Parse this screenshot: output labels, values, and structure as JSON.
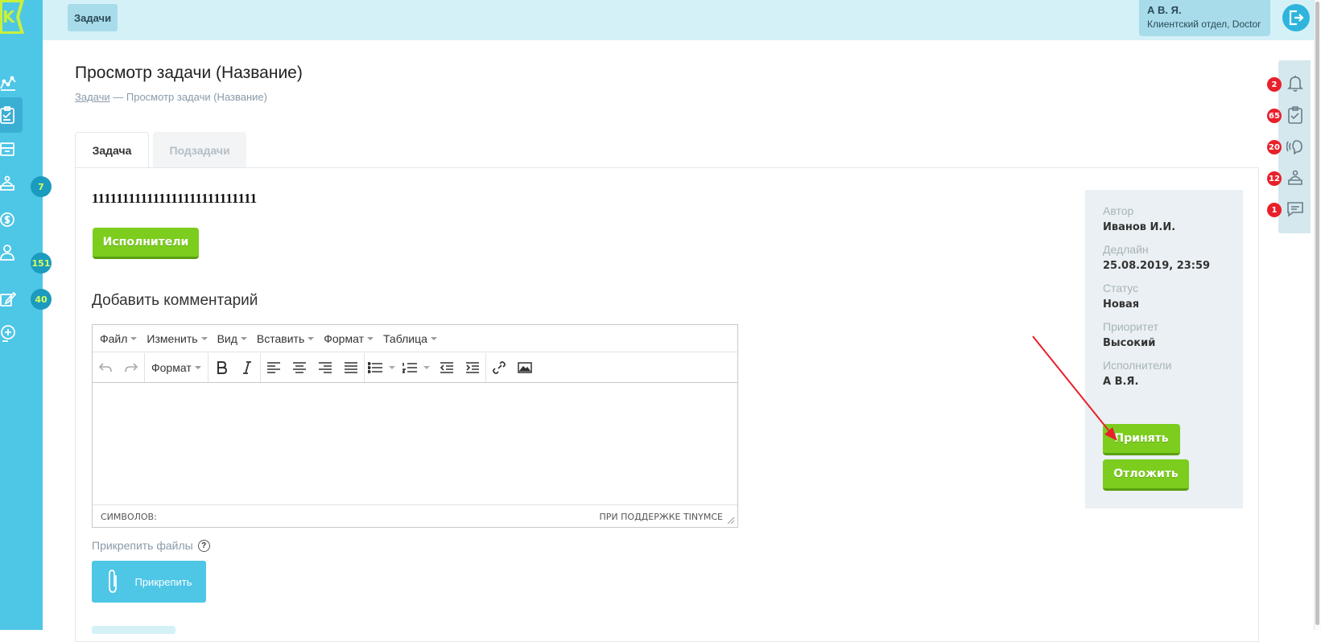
{
  "header": {
    "tab_label": "Задачи",
    "user_name": "А В. Я.",
    "user_dept": "Клиентский отдел, Doctor"
  },
  "sidebar": {
    "logo_letter": "K",
    "items": [
      {
        "icon": "chart-icon"
      },
      {
        "icon": "tasks-icon",
        "active": true
      },
      {
        "icon": "archive-icon"
      },
      {
        "icon": "reception-icon",
        "badge": "7"
      },
      {
        "icon": "money-icon"
      },
      {
        "icon": "clients-icon",
        "badge": "151"
      },
      {
        "icon": "edit-icon",
        "badge": "40"
      },
      {
        "icon": "add-user-icon"
      }
    ]
  },
  "right_panel": {
    "items": [
      {
        "icon": "bell-icon",
        "badge": "2"
      },
      {
        "icon": "tasks-icon",
        "badge": "65"
      },
      {
        "icon": "call-icon",
        "badge": "20"
      },
      {
        "icon": "reception-icon",
        "badge": "12"
      },
      {
        "icon": "chat-icon",
        "badge": "1"
      }
    ]
  },
  "page": {
    "title": "Просмотр задачи (Название)",
    "breadcrumb_link": "Задачи",
    "breadcrumb_rest": " — Просмотр задачи (Название)"
  },
  "tabs": [
    {
      "label": "Задача",
      "active": true
    },
    {
      "label": "Подзадачи",
      "active": false
    }
  ],
  "task": {
    "text": "111111111111111111111111111",
    "executors_button": "Исполнители"
  },
  "comment": {
    "heading": "Добавить комментарий",
    "menu": [
      "Файл",
      "Изменить",
      "Вид",
      "Вставить",
      "Формат",
      "Таблица"
    ],
    "format_select": "Формат",
    "status_left": "СИМВОЛОВ:",
    "status_right": "ПРИ ПОДДЕРЖКЕ TINYMCE"
  },
  "attach": {
    "label": "Прикрепить файлы",
    "help": "?",
    "button": "Прикрепить"
  },
  "info": {
    "author_label": "Автор",
    "author": "Иванов И.И.",
    "deadline_label": "Дедлайн",
    "deadline": "25.08.2019, 23:59",
    "status_label": "Статус",
    "status": "Новая",
    "priority_label": "Приоритет",
    "priority": "Высокий",
    "executors_label": "Исполнители",
    "executors": "А В.Я.",
    "accept_button": "Принять",
    "postpone_button": "Отложить"
  },
  "colors": {
    "accent": "#4ec6e6",
    "green": "#7ccd1e",
    "badge_red": "#e8202a",
    "annotation_arrow": "#e8202a"
  }
}
